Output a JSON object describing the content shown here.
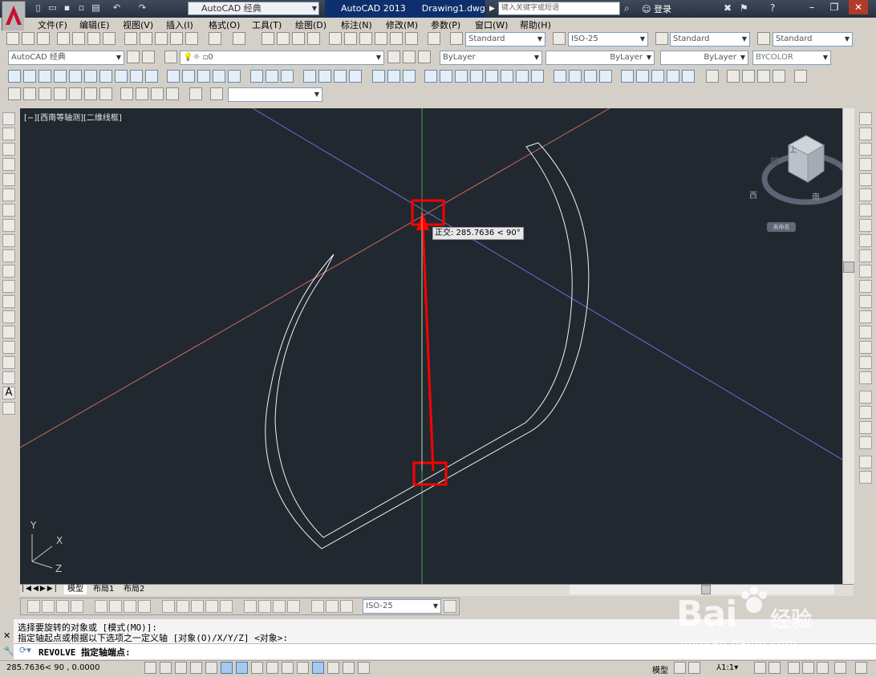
{
  "window": {
    "workspace": "AutoCAD 经典",
    "app_title": "AutoCAD 2013",
    "file_name": "Drawing1.dwg",
    "search_placeholder": "键入关键字或短语",
    "login_label": "登录"
  },
  "menus": [
    "文件(F)",
    "编辑(E)",
    "视图(V)",
    "插入(I)",
    "格式(O)",
    "工具(T)",
    "绘图(D)",
    "标注(N)",
    "修改(M)",
    "参数(P)",
    "窗口(W)",
    "帮助(H)"
  ],
  "styles": {
    "text_style": "Standard",
    "dim_style": "ISO-25",
    "table_style": "Standard",
    "multileader_style": "Standard"
  },
  "layers": {
    "workspace": "AutoCAD 经典",
    "current_layer": "0",
    "color": "ByLayer",
    "linetype": "ByLayer",
    "lineweight": "ByLayer",
    "plotstyle": "BYCOLOR"
  },
  "viewport": {
    "label": "[−][西南等轴测][二维线框]",
    "tooltip": "正交: 285.7636 < 90°",
    "viewcube_faces": [
      "前",
      "上"
    ],
    "viewcube_compass": [
      "西",
      "南"
    ],
    "viewcube_label": "未命名",
    "ucs": [
      "Y",
      "X",
      "Z"
    ]
  },
  "tabs": [
    "模型",
    "布局1",
    "布局2"
  ],
  "dim_toolbar": {
    "dim_style": "ISO-25"
  },
  "command": {
    "history": [
      "选择要旋转的对象或 [模式(MO)]:",
      "指定轴起点或根据以下选项之一定义轴 [对象(O)/X/Y/Z] <对象>:"
    ],
    "current": "REVOLVE 指定轴端点:"
  },
  "status": {
    "coords": "285.7636< 90   , 0.0000",
    "model": "模型",
    "scale": "1:1"
  },
  "watermark": {
    "brand": "Bai",
    "brand2": "经验",
    "url": "jingyan.baidu.com"
  },
  "colors": {
    "canvas": "#212830",
    "highlight": "#ff0000",
    "axis_x": "#c96b5b",
    "axis_y": "#49a349",
    "axis_z": "#6b6fd0"
  }
}
